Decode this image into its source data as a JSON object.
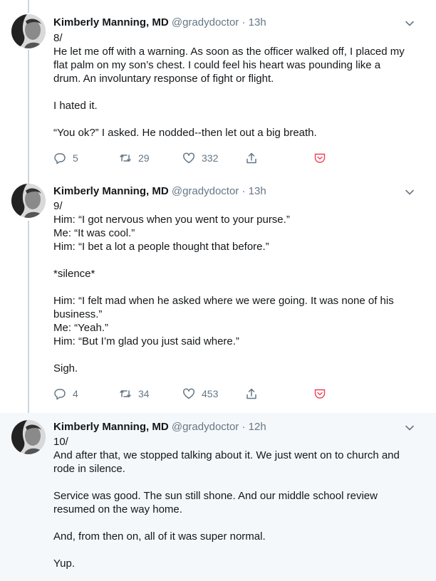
{
  "author": {
    "name": "Kimberly Manning, MD",
    "handle": "@gradydoctor"
  },
  "tweets": [
    {
      "time": "13h",
      "lines": [
        "8/",
        "He let me off with a warning. As soon as the officer walked off, I placed my",
        "flat palm on my son’s chest. I could feel his heart was pounding like a",
        "drum. An involuntary response of fight or flight.",
        "",
        "I hated it.",
        "",
        "“You ok?” I asked. He nodded--then let out a big breath."
      ],
      "replies": "5",
      "retweets": "29",
      "likes": "332"
    },
    {
      "time": "13h",
      "lines": [
        "9/",
        "Him: “I got nervous when you went to your purse.”",
        "Me: “It was cool.”",
        "Him: “I bet a lot a people thought that before.”",
        "",
        "*silence*",
        "",
        "Him: “I felt mad when he asked where we were going. It was none of his",
        "business.”",
        "Me: “Yeah.”",
        "Him: “But I’m glad you just said where.”",
        "",
        "Sigh."
      ],
      "replies": "4",
      "retweets": "34",
      "likes": "453"
    },
    {
      "time": "12h",
      "lines": [
        "10/",
        "And after that, we stopped talking about it. We just went on to church and",
        "rode in silence.",
        "",
        "Service was good. The sun still shone. And our middle school review",
        "resumed on the way home.",
        "",
        "And, from then on, all of it was super normal.",
        "",
        "Yup."
      ]
    }
  ],
  "separator": "·",
  "icons": {
    "reply": "reply-icon",
    "retweet": "retweet-icon",
    "like": "heart-icon",
    "share": "share-icon",
    "pocket": "pocket-icon",
    "menu": "chevron-down-icon"
  },
  "colors": {
    "text": "#14171a",
    "muted": "#657786",
    "pocket": "#ef4056",
    "highlight_bg": "#f5f8fa",
    "thread_line": "#ccd6dd"
  }
}
